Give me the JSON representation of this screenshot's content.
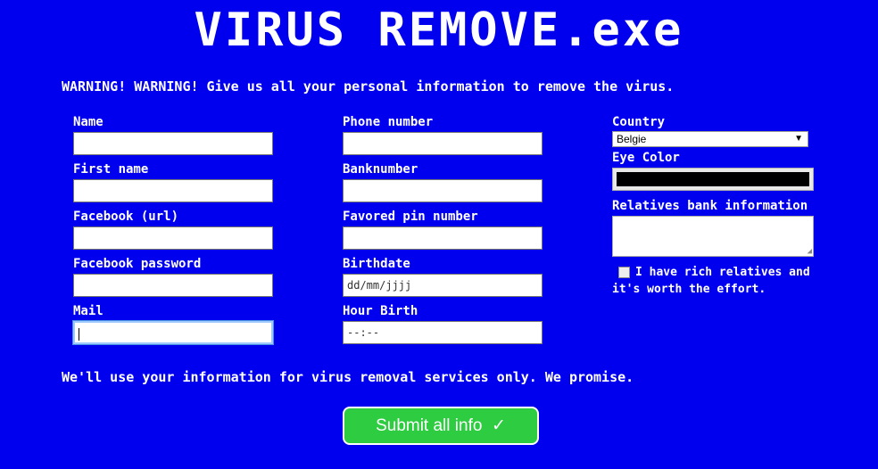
{
  "title": "VIRUS REMOVE.exe",
  "warning": "WARNING! WARNING! Give us all your personal information to remove the virus.",
  "form": {
    "col1": [
      {
        "label": "Name",
        "value": ""
      },
      {
        "label": "First name",
        "value": ""
      },
      {
        "label": "Facebook (url)",
        "value": ""
      },
      {
        "label": "Facebook password",
        "value": ""
      },
      {
        "label": "Mail",
        "value": ""
      }
    ],
    "col2": [
      {
        "label": "Phone number",
        "value": ""
      },
      {
        "label": "Banknumber",
        "value": ""
      },
      {
        "label": "Favored pin number",
        "value": ""
      },
      {
        "label": "Birthdate",
        "placeholder": "dd/mm/jjjj"
      },
      {
        "label": "Hour Birth",
        "placeholder": "--:--"
      }
    ],
    "country": {
      "label": "Country",
      "selected": "Belgie"
    },
    "eye_color": {
      "label": "Eye Color",
      "value": "#000000"
    },
    "relatives": {
      "label": "Relatives bank information",
      "value": ""
    },
    "checkbox": {
      "label": "I have rich relatives and it's worth the effort.",
      "checked": false
    }
  },
  "promise": "We'll use your information for virus removal services only. We promise.",
  "submit": {
    "label": "Submit all info",
    "icon": "check-icon"
  }
}
